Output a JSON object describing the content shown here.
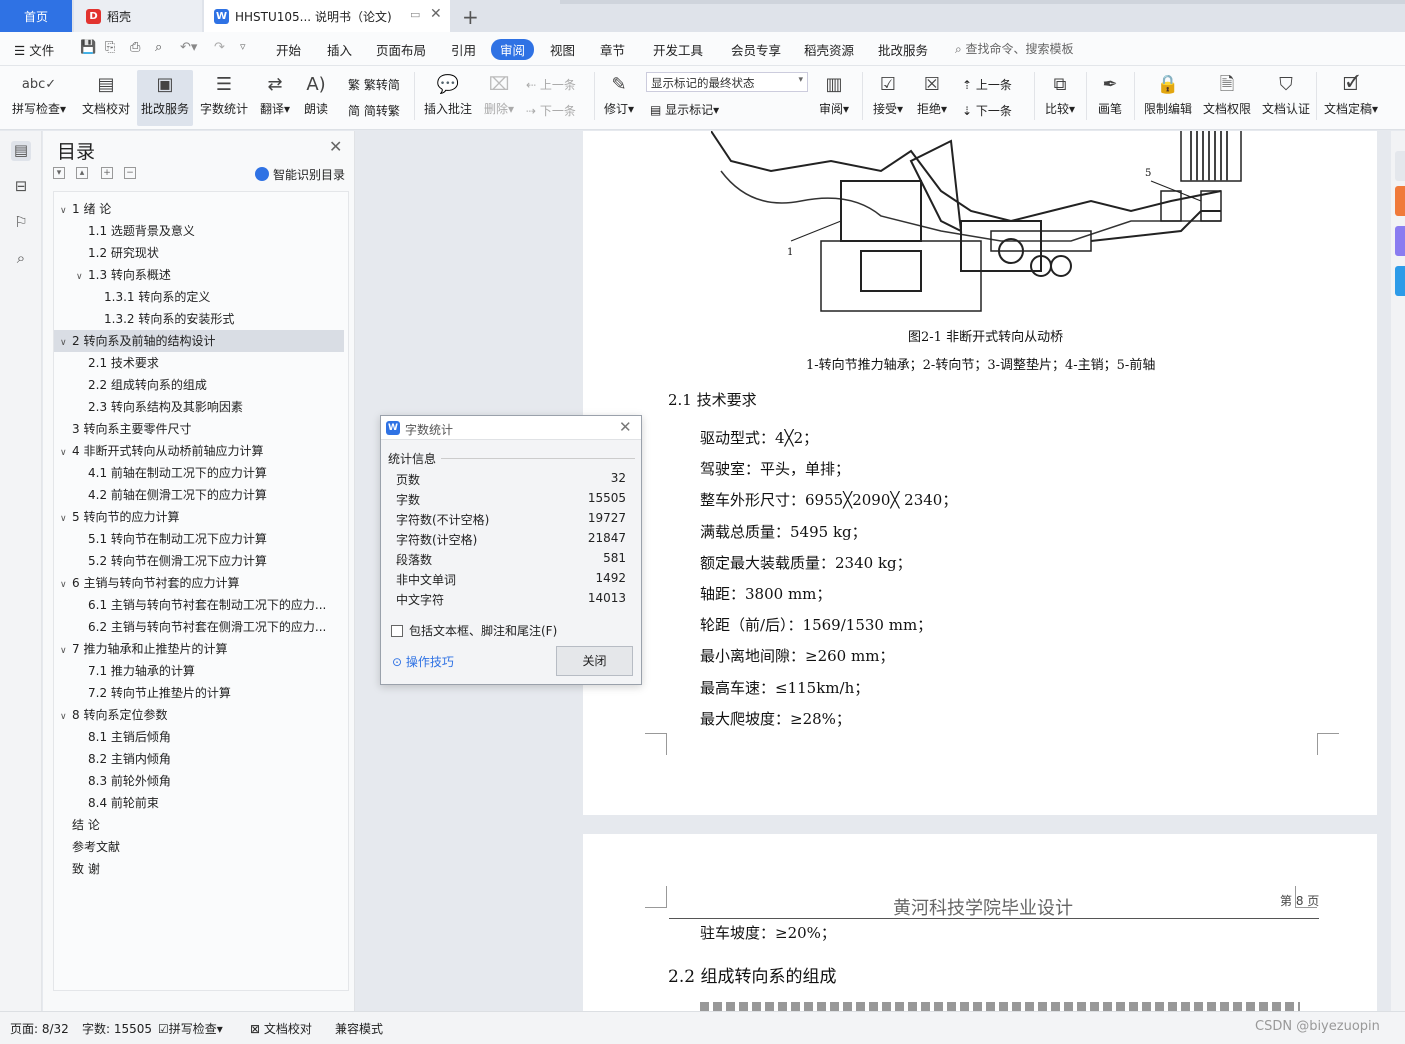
{
  "tabs": {
    "home": "首页",
    "daoke": "稻壳",
    "doc": "HHSTU105... 说明书（论文)"
  },
  "menu": {
    "file": "文件",
    "items": [
      "开始",
      "插入",
      "页面布局",
      "引用",
      "审阅",
      "视图",
      "章节",
      "开发工具",
      "会员专享",
      "稻壳资源",
      "批改服务"
    ],
    "active": "审阅",
    "search": "查找命令、搜索模板"
  },
  "toolbar": {
    "spell": "拼写检查",
    "proof": "文档校对",
    "correct": "批改服务",
    "wordcount": "字数统计",
    "translate": "翻译",
    "read": "朗读",
    "trad": "繁转简",
    "simp": "简转繁",
    "insert_comment": "插入批注",
    "delete": "删除",
    "prev": "上一条",
    "next": "下一条",
    "revise": "修订",
    "markup_state": "显示标记的最终状态",
    "show_markup": "显示标记",
    "review": "审阅",
    "accept": "接受",
    "reject": "拒绝",
    "prev2": "上一条",
    "next2": "下一条",
    "compare": "比较",
    "pen": "画笔",
    "restrict": "限制编辑",
    "perm": "文档权限",
    "certify": "文档认证",
    "finalize": "文档定稿"
  },
  "toc": {
    "title": "目录",
    "smart": "智能识别目录",
    "items": [
      {
        "text": "1 绪    论",
        "level": 1,
        "arrow": true
      },
      {
        "text": "1.1 选题背景及意义",
        "level": 2
      },
      {
        "text": "1.2 研究现状",
        "level": 2
      },
      {
        "text": "1.3 转向系概述",
        "level": 2,
        "arrow": true
      },
      {
        "text": "1.3.1 转向系的定义",
        "level": 3
      },
      {
        "text": "1.3.2 转向系的安装形式",
        "level": 3
      },
      {
        "text": "2  转向系及前轴的结构设计",
        "level": 1,
        "arrow": true,
        "selected": true
      },
      {
        "text": "2.1  技术要求",
        "level": 2
      },
      {
        "text": "2.2  组成转向系的组成",
        "level": 2
      },
      {
        "text": "2.3  转向系结构及其影响因素",
        "level": 2
      },
      {
        "text": "3  转向系主要零件尺寸",
        "level": 1
      },
      {
        "text": "4 非断开式转向从动桥前轴应力计算",
        "level": 1,
        "arrow": true
      },
      {
        "text": "4.1 前轴在制动工况下的应力计算",
        "level": 2
      },
      {
        "text": "4.2 前轴在侧滑工况下的应力计算",
        "level": 2
      },
      {
        "text": "5  转向节的应力计算",
        "level": 1,
        "arrow": true
      },
      {
        "text": "5.1 转向节在制动工况下应力计算",
        "level": 2
      },
      {
        "text": "5.2  转向节在侧滑工况下应力计算",
        "level": 2
      },
      {
        "text": "6 主销与转向节衬套的应力计算",
        "level": 1,
        "arrow": true
      },
      {
        "text": "6.1 主销与转向节衬套在制动工况下的应力...",
        "level": 2
      },
      {
        "text": "6.2 主销与转向节衬套在侧滑工况下的应力...",
        "level": 2
      },
      {
        "text": "7  推力轴承和止推垫片的计算",
        "level": 1,
        "arrow": true
      },
      {
        "text": "7.1 推力轴承的计算",
        "level": 2
      },
      {
        "text": "7.2  转向节止推垫片的计算",
        "level": 2
      },
      {
        "text": "8 转向系定位参数",
        "level": 1,
        "arrow": true
      },
      {
        "text": "8.1  主销后倾角",
        "level": 2
      },
      {
        "text": "8.2  主销内倾角",
        "level": 2
      },
      {
        "text": "8.3  前轮外倾角",
        "level": 2
      },
      {
        "text": "8.4  前轮前束",
        "level": 2
      },
      {
        "text": "结    论",
        "level": 1
      },
      {
        "text": "参考文献",
        "level": 1
      },
      {
        "text": "致    谢",
        "level": 1
      }
    ]
  },
  "document": {
    "fig_label_5": "5",
    "fig_label_1": "1",
    "fig_caption": "图2-1  非断开式转向从动桥",
    "fig_legend": "1-转向节推力轴承；2-转向节；3-调整垫片；4-主销；5-前轴",
    "section_21": "2.1  技术要求",
    "specs": [
      "驱动型式：4╳2；",
      "驾驶室：平头，单排；",
      "整车外形尺寸：6955╳2090╳ 2340；",
      "满载总质量：5495 kg；",
      "额定最大装载质量：2340 kg；",
      "轴距：3800 mm；",
      " 轮距（前/后）：1569/1530 mm；",
      "最小离地间隙：≥260 mm；",
      "最高车速：≤115km/h；",
      "最大爬坡度：≥28%；"
    ],
    "header": "黄河科技学院毕业设计",
    "page_no": "第 8 页",
    "spec_park": "驻车坡度：≥20%；",
    "section_22": "2.2  组成转向系的组成"
  },
  "dialog": {
    "title": "字数统计",
    "group": "统计信息",
    "rows": [
      {
        "label": "页数",
        "value": "32"
      },
      {
        "label": "字数",
        "value": "15505"
      },
      {
        "label": "字符数(不计空格)",
        "value": "19727"
      },
      {
        "label": "字符数(计空格)",
        "value": "21847"
      },
      {
        "label": "段落数",
        "value": "581"
      },
      {
        "label": "非中文单词",
        "value": "1492"
      },
      {
        "label": "中文字符",
        "value": "14013"
      }
    ],
    "include": "包括文本框、脚注和尾注(F)",
    "tips": "操作技巧",
    "close": "关闭"
  },
  "status": {
    "page": "页面: 8/32",
    "words": "字数: 15505",
    "spell": "拼写检查",
    "proof": "文档校对",
    "compat": "兼容模式",
    "watermark": "CSDN @biyezuopin"
  },
  "colors": {
    "accent": "#2f72e4",
    "daoke": "#e2332f"
  }
}
